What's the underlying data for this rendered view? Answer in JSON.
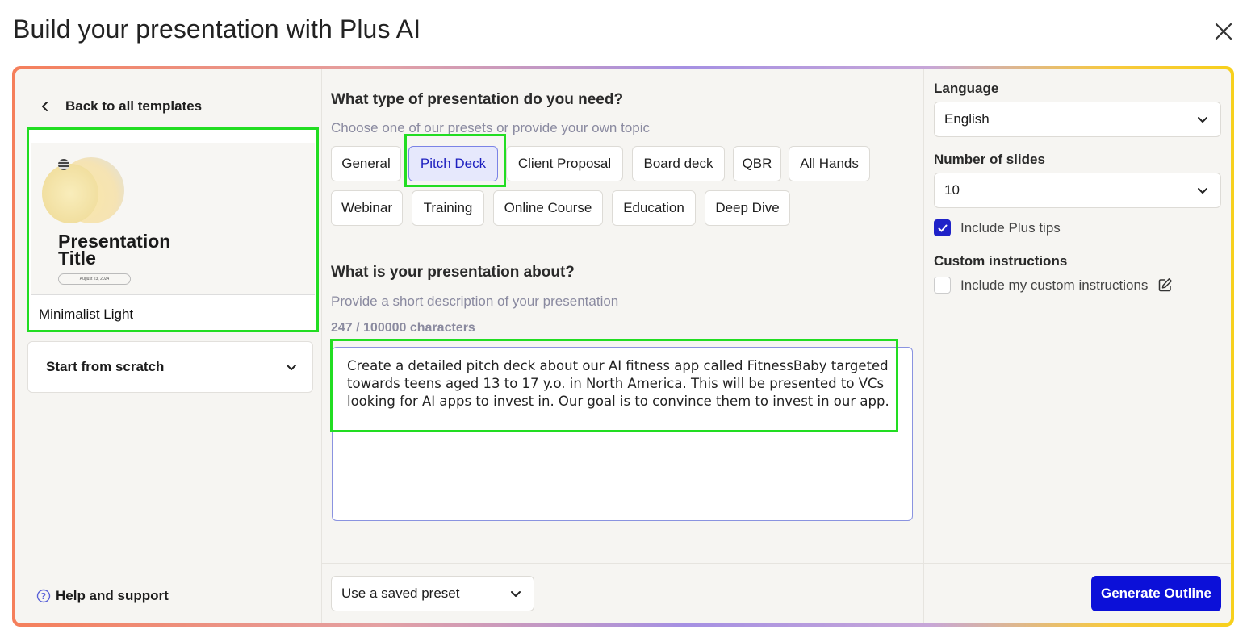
{
  "window": {
    "title": "Build your presentation with Plus AI",
    "close_icon": "close-icon"
  },
  "left": {
    "back_label": "Back to all templates",
    "template": {
      "preview_title": "Presentation Title",
      "preview_date": "August 23, 2024",
      "name": "Minimalist Light"
    },
    "scratch_label": "Start from scratch",
    "help_label": "Help and support"
  },
  "middle": {
    "type_heading": "What type of presentation do you need?",
    "type_sub": "Choose one of our presets or provide your own topic",
    "chips": [
      "General",
      "Pitch Deck",
      "Client Proposal",
      "Board deck",
      "QBR",
      "All Hands",
      "Webinar",
      "Training",
      "Online Course",
      "Education",
      "Deep Dive"
    ],
    "selected_chip": "Pitch Deck",
    "about_heading": "What is your presentation about?",
    "about_sub": "Provide a short description of your presentation",
    "counter": "247 / 100000 characters",
    "description": "Create a detailed pitch deck about our AI fitness app called FitnessBaby targeted towards teens aged 13 to 17 y.o. in North America. This will be presented to VCs looking for AI apps to invest in. Our goal is to convince them to invest in our app.",
    "preset_label": "Use a saved preset"
  },
  "right": {
    "language_label": "Language",
    "language_value": "English",
    "slides_label": "Number of slides",
    "slides_value": "10",
    "tips_label": "Include Plus tips",
    "tips_checked": true,
    "custom_label": "Custom instructions",
    "custom_check_label": "Include my custom instructions",
    "custom_checked": false,
    "generate_label": "Generate Outline"
  },
  "colors": {
    "accent": "#0c10d8",
    "highlight": "#22dd22",
    "selected_chip_bg": "#e6e8fc"
  }
}
